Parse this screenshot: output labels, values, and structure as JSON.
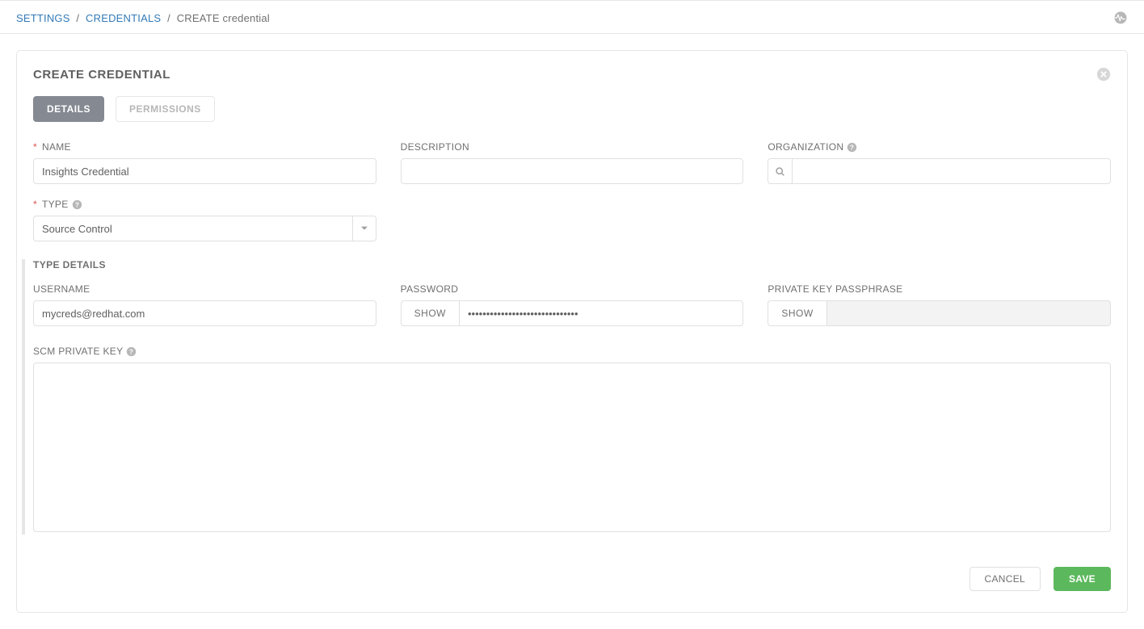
{
  "breadcrumb": {
    "settings": "SETTINGS",
    "credentials": "CREDENTIALS",
    "current": "CREATE credential"
  },
  "panel": {
    "title": "CREATE CREDENTIAL"
  },
  "tabs": {
    "details": "DETAILS",
    "permissions": "PERMISSIONS"
  },
  "fields": {
    "name_label": "NAME",
    "name_value": "Insights Credential",
    "description_label": "DESCRIPTION",
    "description_value": "",
    "organization_label": "ORGANIZATION",
    "organization_value": "",
    "type_label": "TYPE",
    "type_value": "Source Control"
  },
  "type_details": {
    "header": "TYPE DETAILS",
    "username_label": "USERNAME",
    "username_value": "mycreds@redhat.com",
    "password_label": "PASSWORD",
    "password_value": "••••••••••••••••••••••••••••••",
    "passphrase_label": "PRIVATE KEY PASSPHRASE",
    "passphrase_value": "",
    "scm_key_label": "SCM PRIVATE KEY",
    "scm_key_value": "",
    "show_label": "SHOW"
  },
  "actions": {
    "cancel": "CANCEL",
    "save": "SAVE"
  }
}
